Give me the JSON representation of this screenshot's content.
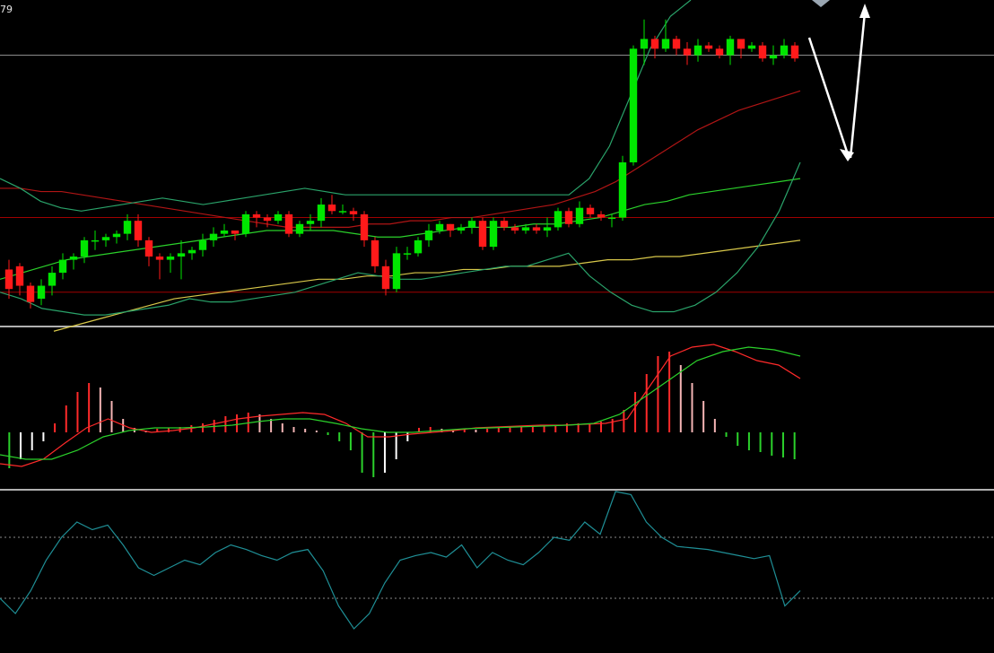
{
  "corner_label": "79",
  "colors": {
    "background": "#000000",
    "up_candle": "#00e600",
    "down_candle": "#ff1a1a",
    "bollinger": "#2aa36a",
    "ma_red": "#b01515",
    "ma_green": "#2bd12b",
    "ma_yellow": "#d8c84a",
    "hline_red": "#a00000",
    "hline_gray": "#8a8a8a",
    "panel_separator": "#b0b0b0",
    "macd_dif": "#ff2a2a",
    "macd_dea": "#2bd12b",
    "rsi_line": "#1f8f96",
    "arrow": "#ffffff"
  },
  "chart_data": [
    {
      "type": "candlestick",
      "title": "",
      "ylim": [
        0,
        100
      ],
      "candles": [
        [
          17,
          11,
          20,
          8
        ],
        [
          18,
          12,
          19,
          9
        ],
        [
          12,
          7,
          13,
          5
        ],
        [
          8,
          12,
          14,
          6
        ],
        [
          12,
          16,
          18,
          9
        ],
        [
          16,
          20,
          22,
          14
        ],
        [
          20,
          21,
          22,
          17
        ],
        [
          21,
          26,
          27,
          19
        ],
        [
          26,
          26,
          29,
          23
        ],
        [
          26,
          27,
          28,
          24
        ],
        [
          27,
          28,
          29,
          25
        ],
        [
          28,
          32,
          34,
          26
        ],
        [
          32,
          26,
          34,
          24
        ],
        [
          26,
          21,
          27,
          18
        ],
        [
          21,
          20,
          22,
          14
        ],
        [
          20,
          21,
          22,
          16
        ],
        [
          21,
          22,
          26,
          14
        ],
        [
          22,
          23,
          24,
          20
        ],
        [
          23,
          26,
          28,
          21
        ],
        [
          26,
          28,
          30,
          24
        ],
        [
          28,
          29,
          31,
          27
        ],
        [
          29,
          28,
          29,
          26
        ],
        [
          28,
          34,
          35,
          27
        ],
        [
          34,
          33,
          35,
          30
        ],
        [
          33,
          32,
          34,
          30
        ],
        [
          32,
          34,
          35,
          31
        ],
        [
          34,
          28,
          35,
          27
        ],
        [
          28,
          31,
          32,
          27
        ],
        [
          31,
          32,
          34,
          29
        ],
        [
          32,
          37,
          39,
          30
        ],
        [
          37,
          35,
          40,
          34
        ],
        [
          35,
          35,
          37,
          34
        ],
        [
          35,
          34,
          36,
          32
        ],
        [
          34,
          26,
          35,
          24
        ],
        [
          26,
          18,
          27,
          16
        ],
        [
          18,
          11,
          20,
          9
        ],
        [
          11,
          22,
          24,
          10
        ],
        [
          22,
          22,
          24,
          20
        ],
        [
          22,
          26,
          27,
          21
        ],
        [
          26,
          29,
          31,
          24
        ],
        [
          29,
          31,
          32,
          28
        ],
        [
          31,
          29,
          31,
          27
        ],
        [
          29,
          30,
          31,
          28
        ],
        [
          30,
          32,
          33,
          28
        ],
        [
          32,
          24,
          33,
          23
        ],
        [
          24,
          32,
          33,
          23
        ],
        [
          32,
          30,
          33,
          29
        ],
        [
          30,
          29,
          31,
          28
        ],
        [
          29,
          30,
          31,
          28
        ],
        [
          30,
          29,
          31,
          28
        ],
        [
          29,
          30,
          33,
          27
        ],
        [
          30,
          35,
          36,
          29
        ],
        [
          35,
          31,
          36,
          30
        ],
        [
          31,
          36,
          38,
          30
        ],
        [
          36,
          34,
          37,
          33
        ],
        [
          34,
          33,
          35,
          32
        ],
        [
          33,
          33,
          34,
          30
        ],
        [
          33,
          50,
          52,
          32
        ],
        [
          50,
          85,
          86,
          49
        ],
        [
          85,
          88,
          94,
          80
        ],
        [
          88,
          85,
          89,
          82
        ],
        [
          85,
          88,
          94,
          84
        ],
        [
          88,
          85,
          89,
          83
        ],
        [
          85,
          83,
          87,
          80
        ],
        [
          83,
          86,
          88,
          81
        ],
        [
          86,
          85,
          87,
          84
        ],
        [
          85,
          83,
          86,
          82
        ],
        [
          83,
          88,
          89,
          80
        ],
        [
          88,
          85,
          88,
          82
        ],
        [
          85,
          86,
          87,
          84
        ],
        [
          86,
          82,
          87,
          81
        ],
        [
          82,
          83,
          86,
          80
        ],
        [
          83,
          86,
          88,
          82
        ],
        [
          86,
          82,
          87,
          81
        ]
      ],
      "series": [
        {
          "kind": "ma_red",
          "values": [
            42,
            42,
            41,
            41,
            40,
            39,
            38,
            37,
            36,
            35,
            34,
            33,
            32,
            31,
            30,
            30,
            30,
            30,
            31,
            31,
            32,
            32,
            33,
            33,
            34,
            35,
            36,
            37,
            39,
            41,
            44,
            48,
            52,
            56,
            60,
            63,
            66,
            68,
            70,
            72
          ]
        },
        {
          "kind": "ma_green",
          "values": [
            14,
            16,
            18,
            20,
            21,
            22,
            23,
            24,
            25,
            26,
            27,
            28,
            29,
            29,
            29,
            29,
            28,
            27,
            27,
            28,
            29,
            30,
            30,
            30,
            31,
            31,
            32,
            33,
            35,
            37,
            38,
            40,
            41,
            42,
            43,
            44,
            45
          ]
        },
        {
          "kind": "ma_yellow",
          "values": [
            -2,
            0,
            2,
            4,
            6,
            8,
            9,
            10,
            11,
            12,
            13,
            14,
            14,
            15,
            15,
            16,
            16,
            17,
            17,
            18,
            18,
            18,
            19,
            20,
            20,
            21,
            21,
            22,
            23,
            24,
            25,
            26
          ]
        },
        {
          "kind": "boll_upper",
          "values": [
            45,
            42,
            38,
            36,
            35,
            36,
            37,
            38,
            39,
            38,
            37,
            38,
            39,
            40,
            41,
            42,
            41,
            40,
            40,
            40,
            40,
            40,
            40,
            40,
            40,
            40,
            40,
            40,
            40,
            45,
            55,
            70,
            85,
            95,
            100
          ]
        },
        {
          "kind": "boll_lower",
          "values": [
            10,
            8,
            5,
            4,
            3,
            3,
            4,
            5,
            6,
            8,
            7,
            7,
            8,
            9,
            10,
            12,
            14,
            16,
            15,
            14,
            14,
            15,
            16,
            17,
            18,
            18,
            20,
            22,
            15,
            10,
            6,
            4,
            4,
            6,
            10,
            16,
            24,
            35,
            50
          ]
        }
      ],
      "hlines": [
        {
          "y": 33,
          "color": "red"
        },
        {
          "y": 10,
          "color": "red"
        },
        {
          "y": 83,
          "color": "gray"
        }
      ]
    },
    {
      "type": "bar",
      "title": "",
      "ylim": [
        -1,
        1
      ],
      "values": [
        -0.4,
        -0.3,
        -0.2,
        -0.1,
        0.1,
        0.3,
        0.45,
        0.55,
        0.5,
        0.35,
        0.15,
        0.05,
        0.02,
        0.04,
        0.05,
        0.06,
        0.08,
        0.1,
        0.14,
        0.18,
        0.2,
        0.22,
        0.2,
        0.15,
        0.1,
        0.06,
        0.04,
        0.02,
        -0.03,
        -0.1,
        -0.2,
        -0.45,
        -0.5,
        -0.45,
        -0.3,
        -0.1,
        0.05,
        0.06,
        0.04,
        0.03,
        0.04,
        0.03,
        0.04,
        0.05,
        0.06,
        0.07,
        0.07,
        0.08,
        0.08,
        0.1,
        0.1,
        0.1,
        0.12,
        0.15,
        0.25,
        0.45,
        0.65,
        0.85,
        0.9,
        0.75,
        0.55,
        0.35,
        0.15,
        -0.05,
        -0.15,
        -0.2,
        -0.22,
        -0.26,
        -0.28,
        -0.3
      ],
      "series": [
        {
          "name": "",
          "kind": "macd_dif",
          "values": [
            -0.35,
            -0.38,
            -0.3,
            -0.12,
            0.05,
            0.15,
            0.05,
            0.0,
            0.02,
            0.05,
            0.1,
            0.15,
            0.18,
            0.2,
            0.22,
            0.2,
            0.1,
            -0.05,
            -0.05,
            -0.02,
            0.0,
            0.02,
            0.05,
            0.06,
            0.07,
            0.08,
            0.08,
            0.09,
            0.1,
            0.15,
            0.5,
            0.85,
            0.95,
            0.98,
            0.9,
            0.8,
            0.75,
            0.6
          ]
        },
        {
          "name": "",
          "kind": "macd_dea",
          "values": [
            -0.25,
            -0.3,
            -0.3,
            -0.2,
            -0.05,
            0.02,
            0.05,
            0.05,
            0.06,
            0.08,
            0.12,
            0.15,
            0.15,
            0.1,
            0.04,
            0.0,
            0.0,
            0.02,
            0.04,
            0.05,
            0.06,
            0.07,
            0.08,
            0.1,
            0.2,
            0.4,
            0.6,
            0.8,
            0.9,
            0.95,
            0.92,
            0.85
          ]
        }
      ]
    },
    {
      "type": "line",
      "title": "",
      "ylim": [
        0,
        100
      ],
      "series": [
        {
          "name": "",
          "kind": "rsi",
          "values": [
            30,
            20,
            35,
            55,
            70,
            80,
            75,
            78,
            65,
            50,
            45,
            50,
            55,
            52,
            60,
            65,
            62,
            58,
            55,
            60,
            62,
            48,
            25,
            10,
            20,
            40,
            55,
            58,
            60,
            57,
            65,
            50,
            60,
            55,
            52,
            60,
            70,
            68,
            80,
            72,
            100,
            98,
            80,
            70,
            64,
            63,
            62,
            60,
            58,
            56,
            58,
            25,
            35
          ]
        }
      ],
      "hlines": [
        {
          "y": 70,
          "style": "dotted"
        },
        {
          "y": 30,
          "style": "dotted"
        }
      ]
    }
  ]
}
